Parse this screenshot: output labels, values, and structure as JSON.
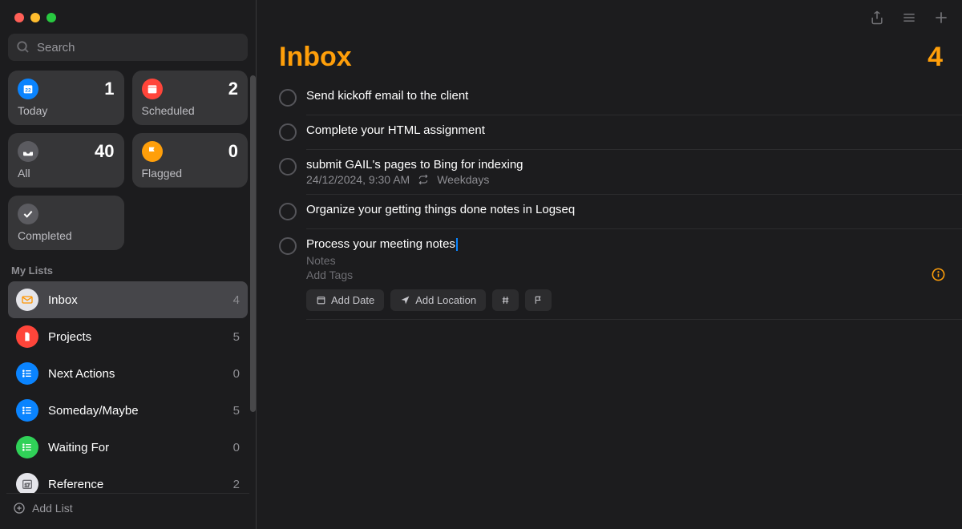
{
  "search": {
    "placeholder": "Search"
  },
  "smartLists": {
    "today": {
      "label": "Today",
      "count": "1"
    },
    "scheduled": {
      "label": "Scheduled",
      "count": "2"
    },
    "all": {
      "label": "All",
      "count": "40"
    },
    "flagged": {
      "label": "Flagged",
      "count": "0"
    },
    "completed": {
      "label": "Completed"
    }
  },
  "listsHeader": "My Lists",
  "lists": [
    {
      "label": "Inbox",
      "count": "4",
      "color": "#e5e5ea",
      "iconFill": "#ff9500"
    },
    {
      "label": "Projects",
      "count": "5",
      "color": "#ff453a"
    },
    {
      "label": "Next Actions",
      "count": "0",
      "color": "#0a84ff"
    },
    {
      "label": "Someday/Maybe",
      "count": "5",
      "color": "#0a84ff"
    },
    {
      "label": "Waiting For",
      "count": "0",
      "color": "#30d158"
    },
    {
      "label": "Reference",
      "count": "2",
      "color": "#e5e5ea"
    }
  ],
  "addList": "Add List",
  "header": {
    "title": "Inbox",
    "count": "4"
  },
  "tasks": [
    {
      "title": "Send kickoff email to the client"
    },
    {
      "title": "Complete your HTML assignment"
    },
    {
      "title": "submit GAIL's pages to Bing for indexing",
      "date": "24/12/2024, 9:30 AM",
      "repeat": "Weekdays"
    },
    {
      "title": "Organize your getting things done notes in Logseq"
    },
    {
      "title": "Process your meeting notes",
      "editing": true
    }
  ],
  "taskEditor": {
    "notesPlaceholder": "Notes",
    "tagsPlaceholder": "Add Tags",
    "addDate": "Add Date",
    "addLocation": "Add Location"
  },
  "colors": {
    "accent": "#ff9f0a",
    "blue": "#0a84ff"
  }
}
